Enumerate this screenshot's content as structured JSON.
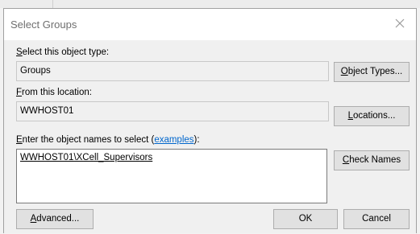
{
  "dialog": {
    "title": "Select Groups",
    "object_type": {
      "label_accel": "S",
      "label_rest": "elect this object type:",
      "value": "Groups",
      "button_accel": "O",
      "button_rest": "bject Types..."
    },
    "location": {
      "label_accel": "F",
      "label_rest": "rom this location:",
      "value": "WWHOST01",
      "button_accel": "L",
      "button_rest": "ocations..."
    },
    "names": {
      "label_accel": "E",
      "label_rest": "nter the object names to select (",
      "label_link": "examples",
      "label_end": "):",
      "value": "WWHOST01\\XCell_Supervisors",
      "check_accel": "C",
      "check_rest": "heck Names"
    },
    "buttons": {
      "advanced_accel": "A",
      "advanced_rest": "dvanced...",
      "ok": "OK",
      "cancel": "Cancel"
    }
  },
  "icons": {
    "close": "close-icon"
  },
  "colors": {
    "link": "#0066cc",
    "accent_underline": "#000000"
  }
}
